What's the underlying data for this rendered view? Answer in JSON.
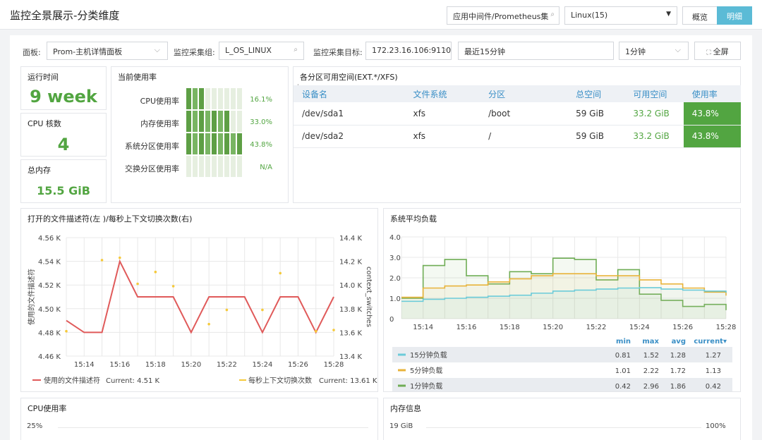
{
  "header": {
    "title": "监控全景展示-分类维度",
    "app_select": "应用中间件/Prometheus集",
    "os_select": "Linux(15)",
    "btn_overview": "概览",
    "btn_detail": "明细"
  },
  "filters": {
    "panel_label": "面板:",
    "panel_value": "Prom-主机详情面板",
    "group_label": "监控采集组:",
    "group_value": "L_OS_LINUX",
    "target_label": "监控采集目标:",
    "target_value": "172.23.16.106:9110",
    "time_range": "最近15分钟",
    "interval": "1分钟",
    "fullscreen": "全屏"
  },
  "stats": {
    "uptime_title": "运行时间",
    "uptime_value": "9 week",
    "cpu_title": "CPU 核数",
    "cpu_value": "4",
    "mem_title": "总内存",
    "mem_value": "15.5 GiB"
  },
  "usage": {
    "title": "当前使用率",
    "rows": [
      {
        "label": "CPU使用率",
        "value": "16.1%",
        "fraction": 0.161
      },
      {
        "label": "内存使用率",
        "value": "33.0%",
        "fraction": 0.33
      },
      {
        "label": "系统分区使用率",
        "value": "43.8%",
        "fraction": 0.438
      },
      {
        "label": "交换分区使用率",
        "value": "N/A",
        "fraction": 0
      }
    ]
  },
  "disk": {
    "title": "各分区可用空间(EXT.*/XFS)",
    "columns": [
      "设备名",
      "文件系统",
      "分区",
      "总空间",
      "可用空间",
      "使用率"
    ],
    "rows": [
      [
        "/dev/sda1",
        "xfs",
        "/boot",
        "59 GiB",
        "33.2 GiB",
        "43.8%"
      ],
      [
        "/dev/sda2",
        "xfs",
        "/",
        "59 GiB",
        "33.2 GiB",
        "43.8%"
      ]
    ]
  },
  "chart_fd": {
    "title": "打开的文件描述符(左 )/每秒上下文切换次数(右)",
    "ylabel_left": "使用的文件描述符",
    "ylabel_right": "context_switches",
    "yticks_left": [
      "4.56 K",
      "4.54 K",
      "4.52 K",
      "4.50 K",
      "4.48 K",
      "4.46 K"
    ],
    "yticks_right": [
      "14.4 K",
      "14.2 K",
      "14.0 K",
      "13.8 K",
      "13.6 K",
      "13.4 K"
    ],
    "xticks": [
      "15:14",
      "15:16",
      "15:18",
      "15:20",
      "15:22",
      "15:24",
      "15:26",
      "15:28"
    ],
    "legend1": "使用的文件描述符",
    "legend1_current": "Current: 4.51 K",
    "legend2": "每秒上下文切换次数",
    "legend2_current": "Current: 13.61 K"
  },
  "chart_load": {
    "title": "系统平均负载",
    "yticks": [
      "4.0",
      "3.0",
      "2.0",
      "1.0",
      "0"
    ],
    "xticks": [
      "15:14",
      "15:16",
      "15:18",
      "15:20",
      "15:22",
      "15:24",
      "15:26",
      "15:28"
    ],
    "headers": [
      "min",
      "max",
      "avg",
      "current▾"
    ],
    "rows": [
      {
        "name": "15分钟负载",
        "min": "0.81",
        "max": "1.52",
        "avg": "1.28",
        "current": "1.27"
      },
      {
        "name": "5分钟负载",
        "min": "1.01",
        "max": "2.22",
        "avg": "1.72",
        "current": "1.13"
      },
      {
        "name": "1分钟负载",
        "min": "0.42",
        "max": "2.96",
        "avg": "1.86",
        "current": "0.42"
      }
    ]
  },
  "chart_data": [
    {
      "type": "line",
      "title": "打开的文件描述符(左 )/每秒上下文切换次数(右)",
      "x": [
        "15:13",
        "15:14",
        "15:15",
        "15:16",
        "15:17",
        "15:18",
        "15:19",
        "15:20",
        "15:21",
        "15:22",
        "15:23",
        "15:24",
        "15:25",
        "15:26",
        "15:27",
        "15:28"
      ],
      "series": [
        {
          "name": "使用的文件描述符",
          "axis": "left",
          "color": "#e05a5a",
          "values": [
            4.49,
            4.48,
            4.48,
            4.54,
            4.51,
            4.51,
            4.51,
            4.48,
            4.51,
            4.51,
            4.51,
            4.48,
            4.51,
            4.51,
            4.48,
            4.51
          ]
        },
        {
          "name": "每秒上下文切换次数",
          "axis": "right",
          "color": "#f5c93a",
          "points": [
            [
              "15:13",
              13.61
            ],
            [
              "15:15",
              14.21
            ],
            [
              "15:16",
              14.23
            ],
            [
              "15:17",
              14.01
            ],
            [
              "15:18",
              14.11
            ],
            [
              "15:19",
              13.99
            ],
            [
              "15:21",
              13.67
            ],
            [
              "15:22",
              13.79
            ],
            [
              "15:24",
              13.79
            ],
            [
              "15:25",
              14.1
            ],
            [
              "15:27",
              13.61
            ],
            [
              "15:28",
              13.62
            ]
          ]
        }
      ],
      "ylim_left": [
        4.46,
        4.56
      ],
      "ylim_right": [
        13.4,
        14.4
      ]
    },
    {
      "type": "area",
      "title": "系统平均负载",
      "x": [
        "15:13",
        "15:14",
        "15:15",
        "15:16",
        "15:17",
        "15:18",
        "15:19",
        "15:20",
        "15:21",
        "15:22",
        "15:23",
        "15:24",
        "15:25",
        "15:26",
        "15:27",
        "15:28"
      ],
      "series": [
        {
          "name": "15分钟负载",
          "color": "#6ccbd9",
          "values": [
            0.85,
            0.95,
            1.0,
            1.05,
            1.1,
            1.15,
            1.25,
            1.35,
            1.4,
            1.45,
            1.5,
            1.52,
            1.45,
            1.4,
            1.35,
            1.27
          ]
        },
        {
          "name": "5分钟负载",
          "color": "#e8b33a",
          "values": [
            1.05,
            1.5,
            1.6,
            1.65,
            1.8,
            1.95,
            2.1,
            2.2,
            2.2,
            2.1,
            2.1,
            1.9,
            1.7,
            1.5,
            1.3,
            1.13
          ]
        },
        {
          "name": "1分钟负载",
          "color": "#6fad55",
          "values": [
            1.0,
            2.6,
            2.9,
            2.1,
            1.7,
            2.3,
            2.2,
            2.96,
            2.9,
            1.9,
            2.4,
            1.2,
            0.9,
            0.6,
            0.7,
            0.42
          ]
        }
      ],
      "ylim": [
        0,
        4
      ]
    }
  ],
  "bottom": {
    "cpu_title": "CPU使用率",
    "cpu_tick": "25%",
    "mem_title": "内存信息",
    "mem_tick_left": "19 GiB",
    "mem_tick_right": "100%"
  },
  "colors": {
    "accent": "#5bbbd6",
    "green": "#52a541",
    "bar": "#5e9f45"
  }
}
